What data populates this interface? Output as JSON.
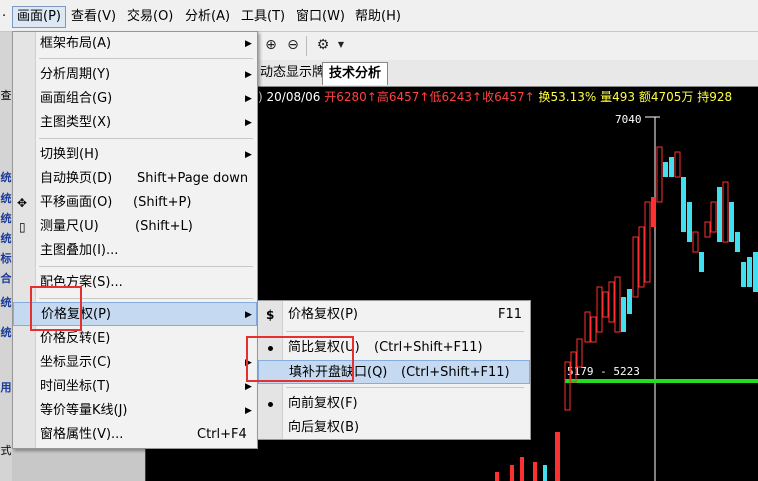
{
  "menubar": {
    "items": [
      "画面(P)",
      "查看(V)",
      "交易(O)",
      "分析(A)",
      "工具(T)",
      "窗口(W)",
      "帮助(H)"
    ]
  },
  "left_strip": {
    "chars": [
      "查",
      "统",
      "统",
      "统",
      "统",
      "标",
      "合",
      "统",
      "统",
      "用",
      "式"
    ]
  },
  "tabs": {
    "items": [
      "动态显示牌",
      "技术分析"
    ]
  },
  "infobar": {
    "prefix": ")",
    "date": "20/08/06",
    "open": "开6280",
    "high": "高6457",
    "low": "低6243",
    "close": "收6457",
    "turnover": "换53.13%",
    "volume": "量493",
    "amount": "额4705万",
    "hold": "持928"
  },
  "chart_data": {
    "type": "candlestick",
    "price_labels": [
      "7040",
      "5179 - 5223"
    ]
  },
  "main_menu": {
    "items": [
      {
        "label": "框架布局(A)",
        "submenu": true
      },
      {
        "label": "分析周期(Y)",
        "submenu": true
      },
      {
        "label": "画面组合(G)",
        "submenu": true
      },
      {
        "label": "主图类型(X)",
        "submenu": true
      },
      {
        "label": "切换到(H)",
        "submenu": true
      },
      {
        "label": "自动换页(D)",
        "shortcut": "Shift+Page down"
      },
      {
        "label": "平移画面(O)",
        "shortcut": "(Shift+P)",
        "icon": "move-icon"
      },
      {
        "label": "测量尺(U)",
        "shortcut": "(Shift+L)",
        "icon": "ruler-icon"
      },
      {
        "label": "主图叠加(I)..."
      },
      {
        "label": "配色方案(S)..."
      },
      {
        "label": "价格复权(P)",
        "submenu": true
      },
      {
        "label": "价格反转(E)"
      },
      {
        "label": "坐标显示(C)",
        "submenu": true
      },
      {
        "label": "时间坐标(T)",
        "submenu": true
      },
      {
        "label": "等价等量K线(J)",
        "submenu": true
      },
      {
        "label": "窗格属性(V)...",
        "shortcut": "Ctrl+F4"
      }
    ]
  },
  "sub_menu": {
    "items": [
      {
        "label": "价格复权(P)",
        "shortcut": "F11",
        "icon": "$"
      },
      {
        "label": "简比复权(U)",
        "shortcut": "(Ctrl+Shift+F11)",
        "checked": true
      },
      {
        "label": "填补开盘缺口(Q)",
        "shortcut": "(Ctrl+Shift+F11)"
      },
      {
        "label": "向前复权(F)",
        "checked": true
      },
      {
        "label": "向后复权(B)"
      }
    ]
  }
}
